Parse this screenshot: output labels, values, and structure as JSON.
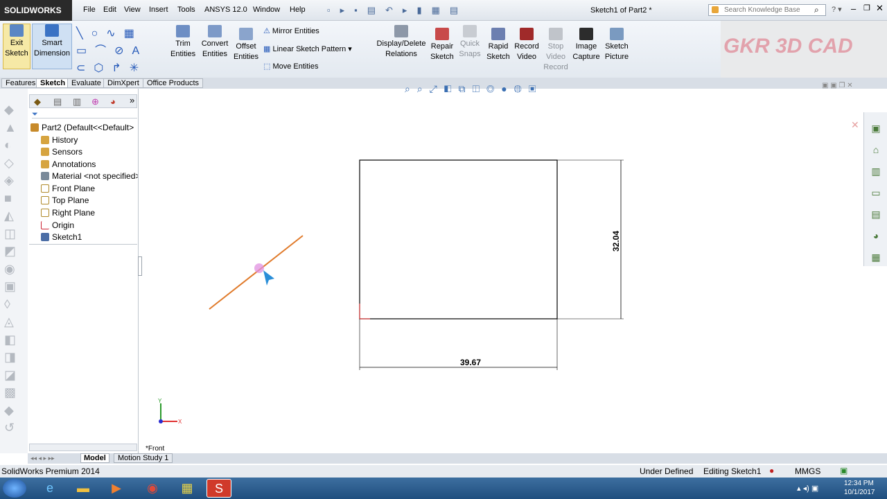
{
  "app": {
    "brand": "SOLIDWORKS",
    "window_title": "Sketch1 of Part2 *",
    "search_placeholder": "Search Knowledge Base",
    "watermark": "GKR 3D CAD"
  },
  "menu": [
    "File",
    "Edit",
    "View",
    "Insert",
    "Tools",
    "ANSYS 12.0",
    "Window",
    "Help"
  ],
  "toolbar": {
    "exit_sketch": "Exit Sketch",
    "smart_dimension": "Smart Dimension",
    "trim_entities": "Trim Entities",
    "convert_entities": "Convert Entities",
    "offset_entities": "Offset Entities",
    "mirror_entities": "Mirror Entities",
    "linear_sketch_pattern": "Linear Sketch Pattern",
    "move_entities": "Move Entities",
    "display_delete_relations": "Display/Delete Relations",
    "repair_sketch": "Repair Sketch",
    "quick_snaps": "Quick Snaps",
    "rapid_sketch": "Rapid Sketch",
    "record_video": "Record Video",
    "stop_video_record": "Stop Video Record",
    "image_capture": "Image Capture",
    "sketch_picture": "Sketch Picture"
  },
  "tabs": [
    "Features",
    "Sketch",
    "Evaluate",
    "DimXpert",
    "Office Products"
  ],
  "active_tab": "Sketch",
  "tree": [
    "Part2  (Default<<Default>",
    "History",
    "Sensors",
    "Annotations",
    "Material <not specified>",
    "Front Plane",
    "Top Plane",
    "Right Plane",
    "Origin",
    "Sketch1"
  ],
  "sketch": {
    "width_dim": "39.67",
    "height_dim": "32.04",
    "view_label": "*Front",
    "axis_x": "X",
    "axis_y": "Y"
  },
  "bottom_tabs": [
    "Model",
    "Motion Study 1"
  ],
  "status": {
    "product": "SolidWorks Premium 2014",
    "state": "Under Defined",
    "mode": "Editing Sketch1",
    "units": "MMGS"
  },
  "taskbar": {
    "time": "12:34 PM",
    "date": "10/1/2017"
  }
}
